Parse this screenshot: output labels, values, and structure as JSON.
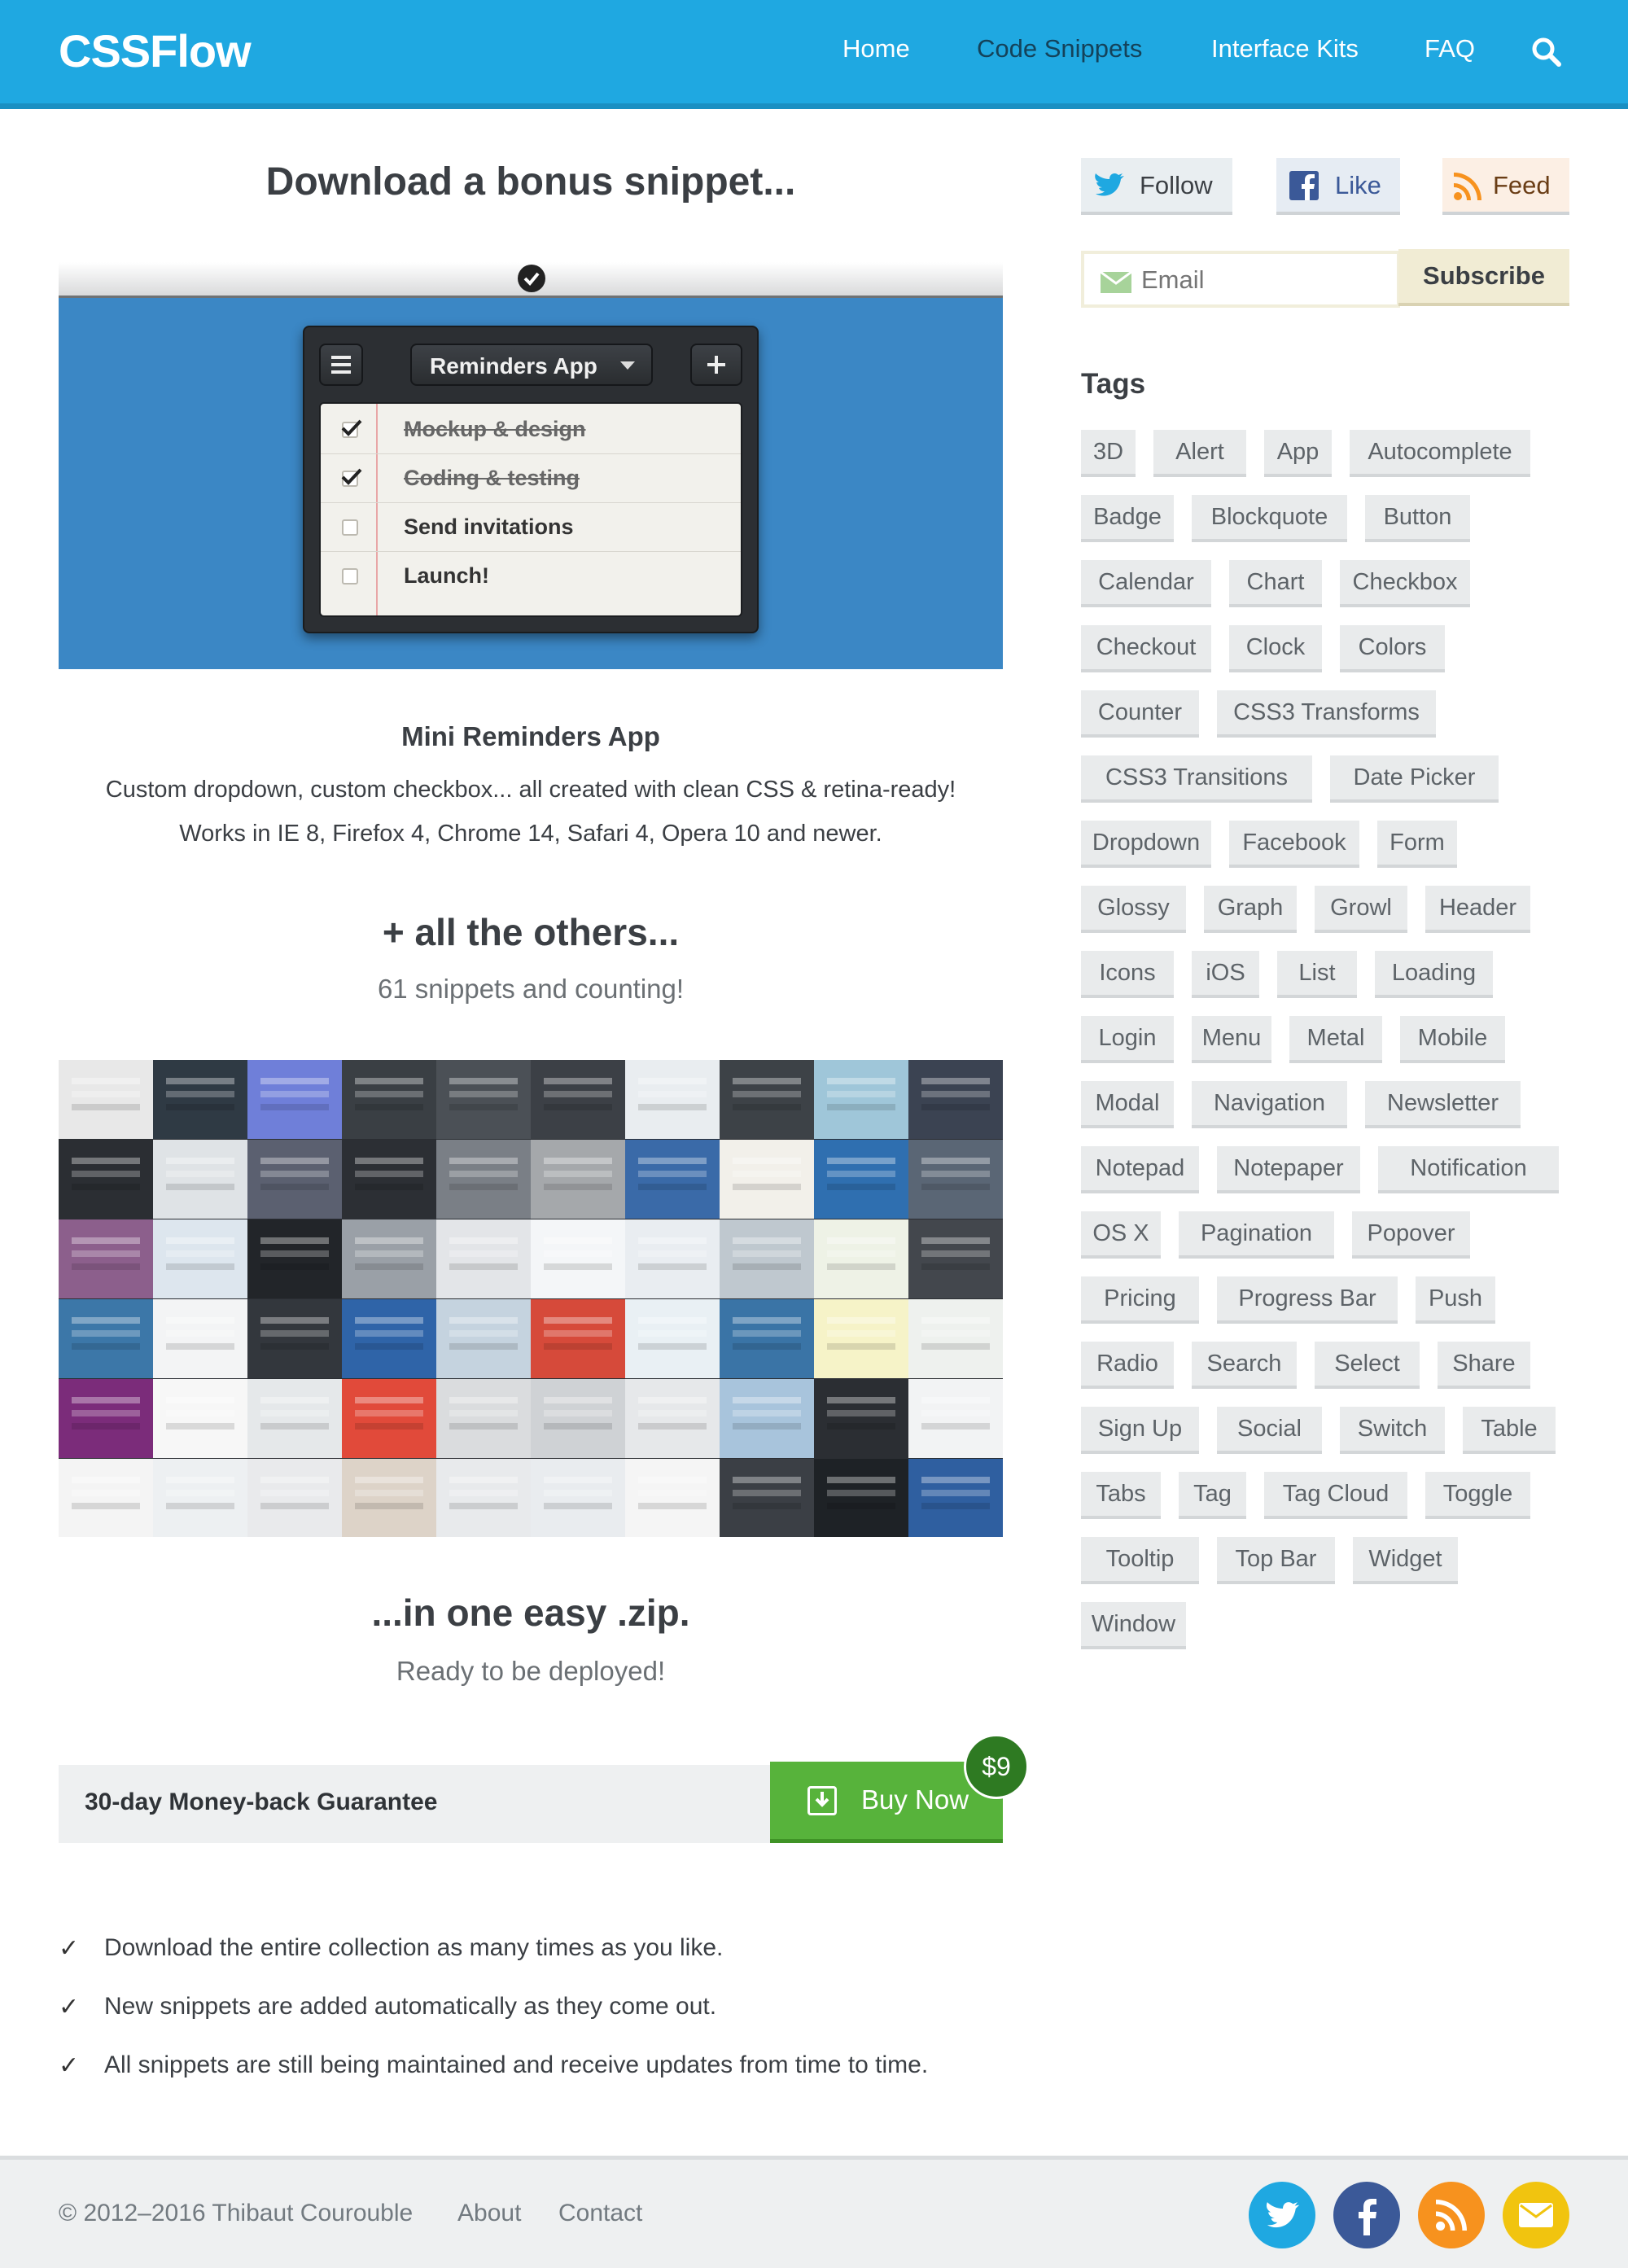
{
  "header": {
    "logo": "CSSFlow",
    "nav": [
      "Home",
      "Code Snippets",
      "Interface Kits",
      "FAQ"
    ],
    "active_nav": "Code Snippets",
    "accent": "#1fa8e1"
  },
  "bonus": {
    "heading": "Download a bonus snippet...",
    "app": {
      "title": "Reminders App",
      "items": [
        {
          "label": "Mockup & design",
          "done": true
        },
        {
          "label": "Coding & testing",
          "done": true
        },
        {
          "label": "Send invitations",
          "done": false
        },
        {
          "label": "Launch!",
          "done": false
        }
      ]
    },
    "name": "Mini Reminders App",
    "description": "Custom dropdown, custom checkbox... all created with clean CSS & retina-ready!",
    "compatibility": "Works in IE 8, Firefox 4, Chrome 14, Safari 4, Opera 10 and newer."
  },
  "others": {
    "heading": "+ all the others...",
    "subheading": "61 snippets and counting!"
  },
  "zip": {
    "heading": "...in one easy .zip.",
    "subheading": "Ready to be deployed!"
  },
  "purchase": {
    "guarantee": "30-day Money-back Guarantee",
    "button": "Buy Now",
    "price": "$9",
    "button_color": "#57b33b"
  },
  "features": [
    "Download the entire collection as many times as you like.",
    "New snippets are added automatically as they come out.",
    "All snippets are still being maintained and receive updates from time to time."
  ],
  "sidebar": {
    "social": [
      {
        "label": "Follow",
        "icon": "twitter-icon"
      },
      {
        "label": "Like",
        "icon": "facebook-icon"
      },
      {
        "label": "Feed",
        "icon": "rss-icon"
      }
    ],
    "email_placeholder": "Email",
    "subscribe": "Subscribe",
    "tags_heading": "Tags",
    "tags": [
      "3D",
      "Alert",
      "App",
      "Autocomplete",
      "Badge",
      "Blockquote",
      "Button",
      "Calendar",
      "Chart",
      "Checkbox",
      "Checkout",
      "Clock",
      "Colors",
      "Counter",
      "CSS3 Transforms",
      "CSS3 Transitions",
      "Date Picker",
      "Dropdown",
      "Facebook",
      "Form",
      "Glossy",
      "Graph",
      "Growl",
      "Header",
      "Icons",
      "iOS",
      "List",
      "Loading",
      "Login",
      "Menu",
      "Metal",
      "Mobile",
      "Modal",
      "Navigation",
      "Newsletter",
      "Notepad",
      "Notepaper",
      "Notification",
      "OS X",
      "Pagination",
      "Popover",
      "Pricing",
      "Progress Bar",
      "Push",
      "Radio",
      "Search",
      "Select",
      "Share",
      "Sign Up",
      "Social",
      "Switch",
      "Table",
      "Tabs",
      "Tag",
      "Tag Cloud",
      "Toggle",
      "Tooltip",
      "Top Bar",
      "Widget",
      "Window"
    ]
  },
  "footer": {
    "copyright": "© 2012–2016 Thibaut Courouble",
    "links": [
      "About",
      "Contact"
    ],
    "icons": [
      "twitter-icon",
      "facebook-icon",
      "rss-icon",
      "email-icon"
    ]
  }
}
